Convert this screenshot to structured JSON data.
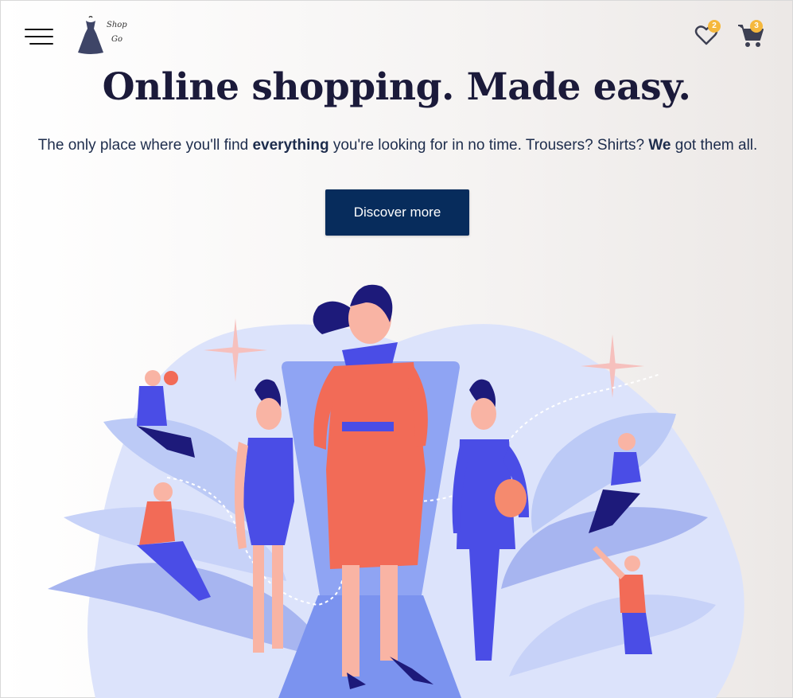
{
  "header": {
    "logo_line1": "Shop",
    "logo_line2": "Go",
    "wishlist_count": "2",
    "cart_count": "3"
  },
  "hero": {
    "title": "Online shopping. Made easy.",
    "tagline_part1": "The only place where you'll find ",
    "tagline_bold1": "everything",
    "tagline_part2": " you're looking for in no time. Trousers? Shirts? ",
    "tagline_bold2": "We",
    "tagline_part3": " got them all.",
    "cta_label": "Discover more"
  },
  "icons": {
    "menu": "hamburger-menu-icon",
    "logo": "dress-icon",
    "wishlist": "heart-icon",
    "cart": "shopping-cart-icon"
  },
  "colors": {
    "cta_background": "#072c5c",
    "badge": "#f5b83d",
    "title": "#1b1a3a",
    "accent_blue": "#4a4de6",
    "accent_coral": "#f26b57"
  }
}
